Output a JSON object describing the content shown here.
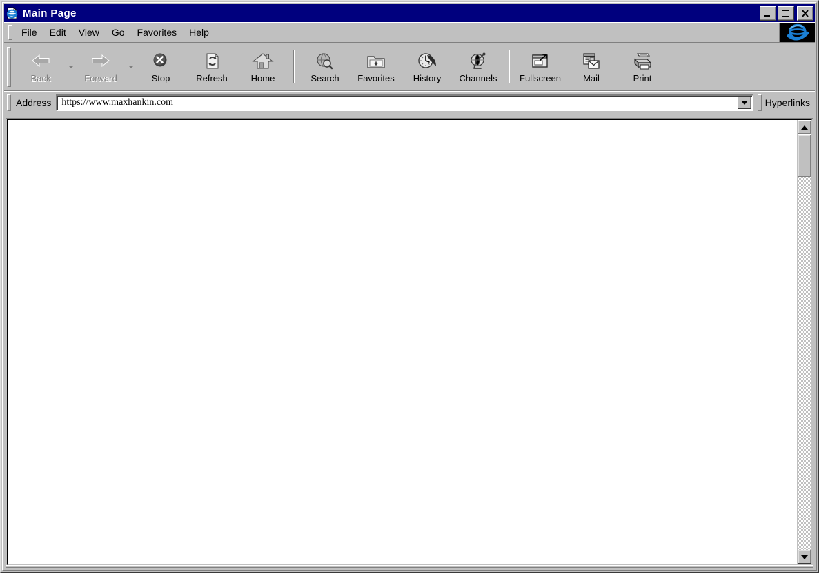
{
  "window": {
    "title": "Main Page",
    "icon": "ie-document-icon",
    "buttons": {
      "minimize": "_",
      "maximize": "□",
      "close": "✕"
    },
    "colors": {
      "titlebar": "#00007e",
      "face": "#c0c0c0",
      "shadow": "#808080",
      "highlight": "#ffffff",
      "ie_blue": "#1a7fd4"
    }
  },
  "menubar": {
    "items": [
      {
        "label": "File",
        "accel": "F",
        "rest": "ile"
      },
      {
        "label": "Edit",
        "accel": "E",
        "rest": "dit"
      },
      {
        "label": "View",
        "accel": "V",
        "rest": "iew"
      },
      {
        "label": "Go",
        "accel": "G",
        "rest": "o"
      },
      {
        "label": "Favorites",
        "pre": "F",
        "accel": "a",
        "rest": "vorites"
      },
      {
        "label": "Help",
        "accel": "H",
        "rest": "elp"
      }
    ],
    "logo_button": "ie-logo-animated"
  },
  "toolbar": {
    "buttons": [
      {
        "label": "Back",
        "icon": "back-arrow-icon",
        "enabled": false,
        "dropdown": true
      },
      {
        "label": "Forward",
        "icon": "forward-arrow-icon",
        "enabled": false,
        "dropdown": true
      },
      {
        "label": "Stop",
        "icon": "stop-icon",
        "enabled": true,
        "dropdown": false
      },
      {
        "label": "Refresh",
        "icon": "refresh-icon",
        "enabled": true,
        "dropdown": false
      },
      {
        "label": "Home",
        "icon": "home-icon",
        "enabled": true,
        "dropdown": false
      },
      {
        "label": "Search",
        "icon": "search-icon",
        "enabled": true,
        "dropdown": false
      },
      {
        "label": "Favorites",
        "icon": "favorites-folder-icon",
        "enabled": true,
        "dropdown": false
      },
      {
        "label": "History",
        "icon": "history-icon",
        "enabled": true,
        "dropdown": false
      },
      {
        "label": "Channels",
        "icon": "channels-dish-icon",
        "enabled": true,
        "dropdown": false
      },
      {
        "label": "Fullscreen",
        "icon": "fullscreen-icon",
        "enabled": true,
        "dropdown": false
      },
      {
        "label": "Mail",
        "icon": "mail-icon",
        "enabled": true,
        "dropdown": false
      },
      {
        "label": "Print",
        "icon": "print-icon",
        "enabled": true,
        "dropdown": false
      }
    ]
  },
  "address": {
    "label": "Address",
    "value": "https://www.maxhankin.com",
    "placeholder": "https://",
    "dropdown_icon": "chevron-down-icon",
    "links_label": "Hyperlinks"
  },
  "content": {
    "body_text": ""
  },
  "scrollbar": {
    "up_icon": "scroll-up-arrow-icon",
    "down_icon": "scroll-down-arrow-icon",
    "thumb": "scroll-thumb"
  }
}
